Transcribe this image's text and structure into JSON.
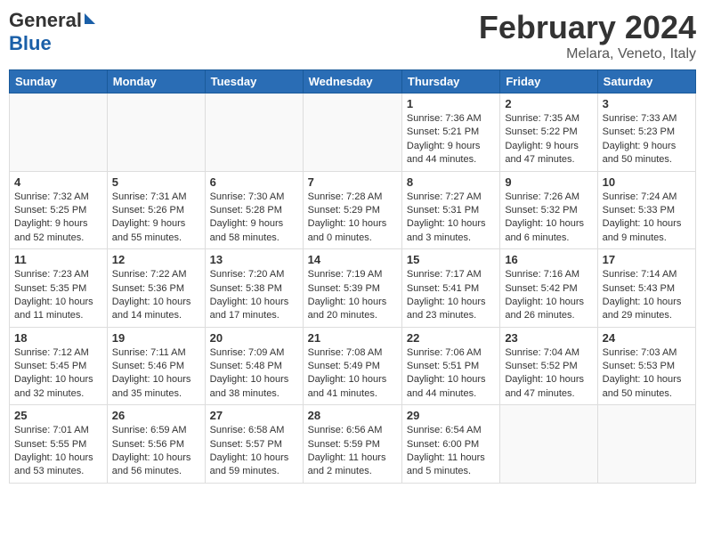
{
  "header": {
    "logo_general": "General",
    "logo_blue": "Blue",
    "title": "February 2024",
    "subtitle": "Melara, Veneto, Italy"
  },
  "weekdays": [
    "Sunday",
    "Monday",
    "Tuesday",
    "Wednesday",
    "Thursday",
    "Friday",
    "Saturday"
  ],
  "weeks": [
    [
      {
        "day": "",
        "detail": ""
      },
      {
        "day": "",
        "detail": ""
      },
      {
        "day": "",
        "detail": ""
      },
      {
        "day": "",
        "detail": ""
      },
      {
        "day": "1",
        "detail": "Sunrise: 7:36 AM\nSunset: 5:21 PM\nDaylight: 9 hours and 44 minutes."
      },
      {
        "day": "2",
        "detail": "Sunrise: 7:35 AM\nSunset: 5:22 PM\nDaylight: 9 hours and 47 minutes."
      },
      {
        "day": "3",
        "detail": "Sunrise: 7:33 AM\nSunset: 5:23 PM\nDaylight: 9 hours and 50 minutes."
      }
    ],
    [
      {
        "day": "4",
        "detail": "Sunrise: 7:32 AM\nSunset: 5:25 PM\nDaylight: 9 hours and 52 minutes."
      },
      {
        "day": "5",
        "detail": "Sunrise: 7:31 AM\nSunset: 5:26 PM\nDaylight: 9 hours and 55 minutes."
      },
      {
        "day": "6",
        "detail": "Sunrise: 7:30 AM\nSunset: 5:28 PM\nDaylight: 9 hours and 58 minutes."
      },
      {
        "day": "7",
        "detail": "Sunrise: 7:28 AM\nSunset: 5:29 PM\nDaylight: 10 hours and 0 minutes."
      },
      {
        "day": "8",
        "detail": "Sunrise: 7:27 AM\nSunset: 5:31 PM\nDaylight: 10 hours and 3 minutes."
      },
      {
        "day": "9",
        "detail": "Sunrise: 7:26 AM\nSunset: 5:32 PM\nDaylight: 10 hours and 6 minutes."
      },
      {
        "day": "10",
        "detail": "Sunrise: 7:24 AM\nSunset: 5:33 PM\nDaylight: 10 hours and 9 minutes."
      }
    ],
    [
      {
        "day": "11",
        "detail": "Sunrise: 7:23 AM\nSunset: 5:35 PM\nDaylight: 10 hours and 11 minutes."
      },
      {
        "day": "12",
        "detail": "Sunrise: 7:22 AM\nSunset: 5:36 PM\nDaylight: 10 hours and 14 minutes."
      },
      {
        "day": "13",
        "detail": "Sunrise: 7:20 AM\nSunset: 5:38 PM\nDaylight: 10 hours and 17 minutes."
      },
      {
        "day": "14",
        "detail": "Sunrise: 7:19 AM\nSunset: 5:39 PM\nDaylight: 10 hours and 20 minutes."
      },
      {
        "day": "15",
        "detail": "Sunrise: 7:17 AM\nSunset: 5:41 PM\nDaylight: 10 hours and 23 minutes."
      },
      {
        "day": "16",
        "detail": "Sunrise: 7:16 AM\nSunset: 5:42 PM\nDaylight: 10 hours and 26 minutes."
      },
      {
        "day": "17",
        "detail": "Sunrise: 7:14 AM\nSunset: 5:43 PM\nDaylight: 10 hours and 29 minutes."
      }
    ],
    [
      {
        "day": "18",
        "detail": "Sunrise: 7:12 AM\nSunset: 5:45 PM\nDaylight: 10 hours and 32 minutes."
      },
      {
        "day": "19",
        "detail": "Sunrise: 7:11 AM\nSunset: 5:46 PM\nDaylight: 10 hours and 35 minutes."
      },
      {
        "day": "20",
        "detail": "Sunrise: 7:09 AM\nSunset: 5:48 PM\nDaylight: 10 hours and 38 minutes."
      },
      {
        "day": "21",
        "detail": "Sunrise: 7:08 AM\nSunset: 5:49 PM\nDaylight: 10 hours and 41 minutes."
      },
      {
        "day": "22",
        "detail": "Sunrise: 7:06 AM\nSunset: 5:51 PM\nDaylight: 10 hours and 44 minutes."
      },
      {
        "day": "23",
        "detail": "Sunrise: 7:04 AM\nSunset: 5:52 PM\nDaylight: 10 hours and 47 minutes."
      },
      {
        "day": "24",
        "detail": "Sunrise: 7:03 AM\nSunset: 5:53 PM\nDaylight: 10 hours and 50 minutes."
      }
    ],
    [
      {
        "day": "25",
        "detail": "Sunrise: 7:01 AM\nSunset: 5:55 PM\nDaylight: 10 hours and 53 minutes."
      },
      {
        "day": "26",
        "detail": "Sunrise: 6:59 AM\nSunset: 5:56 PM\nDaylight: 10 hours and 56 minutes."
      },
      {
        "day": "27",
        "detail": "Sunrise: 6:58 AM\nSunset: 5:57 PM\nDaylight: 10 hours and 59 minutes."
      },
      {
        "day": "28",
        "detail": "Sunrise: 6:56 AM\nSunset: 5:59 PM\nDaylight: 11 hours and 2 minutes."
      },
      {
        "day": "29",
        "detail": "Sunrise: 6:54 AM\nSunset: 6:00 PM\nDaylight: 11 hours and 5 minutes."
      },
      {
        "day": "",
        "detail": ""
      },
      {
        "day": "",
        "detail": ""
      }
    ]
  ]
}
